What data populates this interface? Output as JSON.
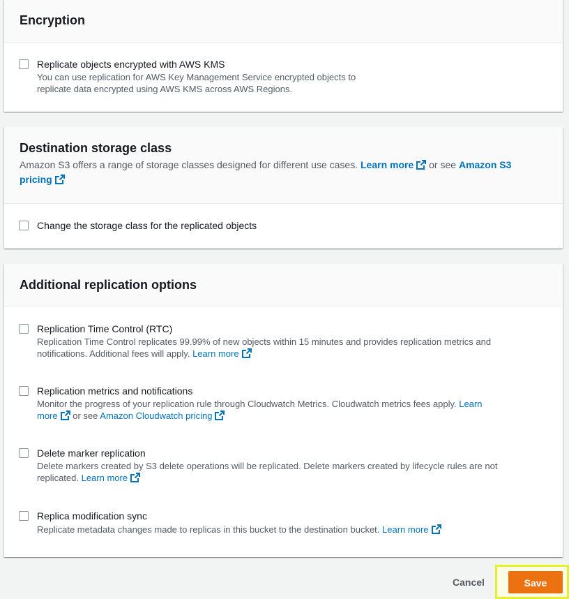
{
  "encryption": {
    "title": "Encryption",
    "kms_label": "Replicate objects encrypted with AWS KMS",
    "kms_desc_line1": "You can use replication for AWS Key Management Service encrypted objects to",
    "kms_desc_line2": "replicate data encrypted using AWS KMS across AWS Regions."
  },
  "storage_class": {
    "title": "Destination storage class",
    "desc": "Amazon S3 offers a range of storage classes designed for different use cases.",
    "learn_more": "Learn more",
    "or_see": "or see",
    "pricing_link_line1": "Amazon S3",
    "pricing_link_line2": "pricing",
    "change_label": "Change the storage class for the replicated objects"
  },
  "additional": {
    "title": "Additional replication options",
    "rtc": {
      "label": "Replication Time Control (RTC)",
      "desc_line1": "Replication Time Control replicates 99.99% of new objects within 15 minutes and provides replication metrics and",
      "desc_line2": "notifications. Additional fees will apply.",
      "link": "Learn more"
    },
    "metrics": {
      "label": "Replication metrics and notifications",
      "desc_line1": "Monitor the progress of your replication rule through Cloudwatch Metrics. Cloudwatch metrics fees apply.",
      "link_part1": "Learn",
      "link_part2": "more",
      "or_see": "or see",
      "pricing_link": "Amazon Cloudwatch pricing"
    },
    "delete_marker": {
      "label": "Delete marker replication",
      "desc_line1": "Delete markers created by S3 delete operations will be replicated. Delete markers created by lifecycle rules are not",
      "desc_line2": "replicated.",
      "link": "Learn more"
    },
    "replica_sync": {
      "label": "Replica modification sync",
      "desc": "Replicate metadata changes made to replicas in this bucket to the destination bucket.",
      "link": "Learn more"
    }
  },
  "footer": {
    "cancel": "Cancel",
    "save": "Save"
  },
  "colors": {
    "link": "#0073bb",
    "primary_button": "#ec7211",
    "highlight": "#e3f22a"
  }
}
